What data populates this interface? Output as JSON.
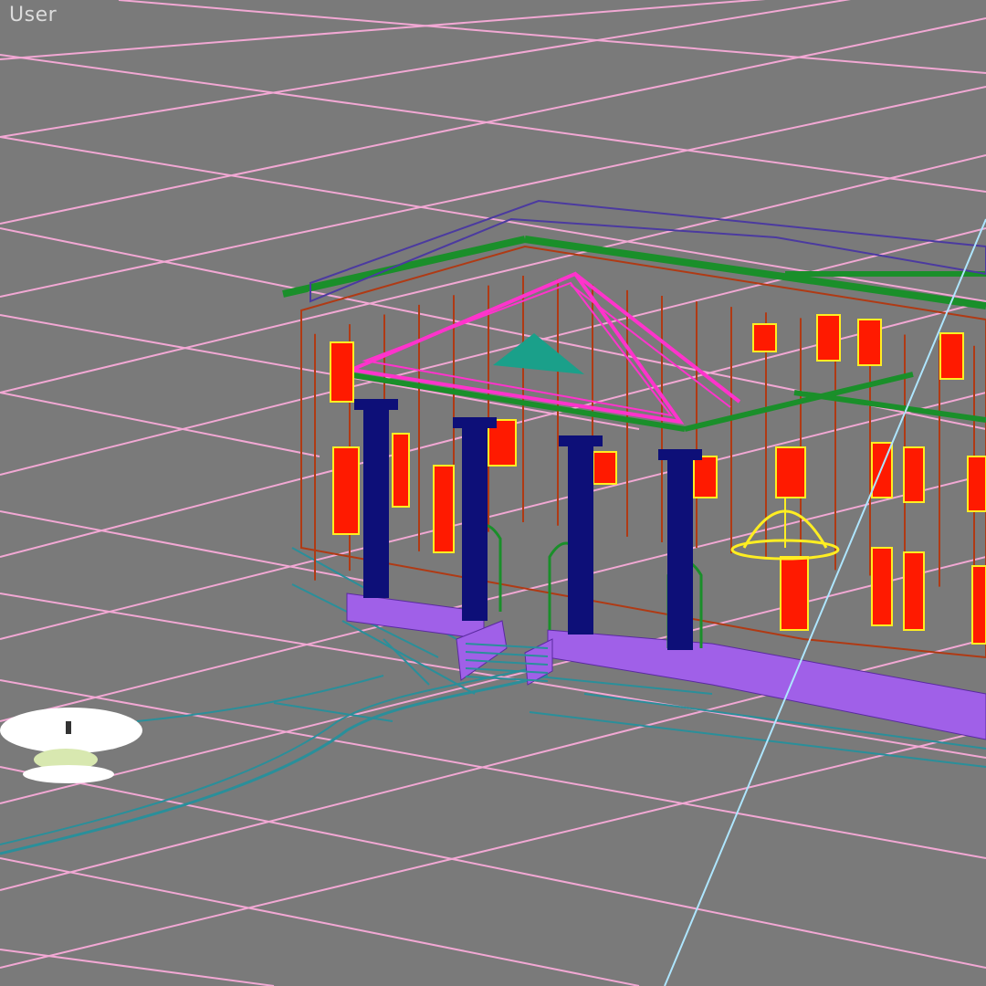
{
  "viewport": {
    "label": "User",
    "background": "#7a7a7a",
    "view_type": "perspective-wireframe"
  },
  "colors": {
    "grid": "#f2a8d4",
    "columns": "#0d0f78",
    "windows": "#ff1a00",
    "window_trim": "#ffee22",
    "roof_edge": "#1a8f2a",
    "pediment": "#ff33cc",
    "plinth": "#a060e8",
    "walls": "#b03a14",
    "ground_lines": "#2a8f9a",
    "light_ray": "#aee6ff",
    "gizmo": "#ffee22",
    "lamp": "#ffffff"
  },
  "objects": {
    "building": "classical-building-wireframe",
    "light": "omni-light-icon",
    "dome_gizmo": "yellow-hemisphere-gizmo",
    "path": "curved-path-spline"
  }
}
